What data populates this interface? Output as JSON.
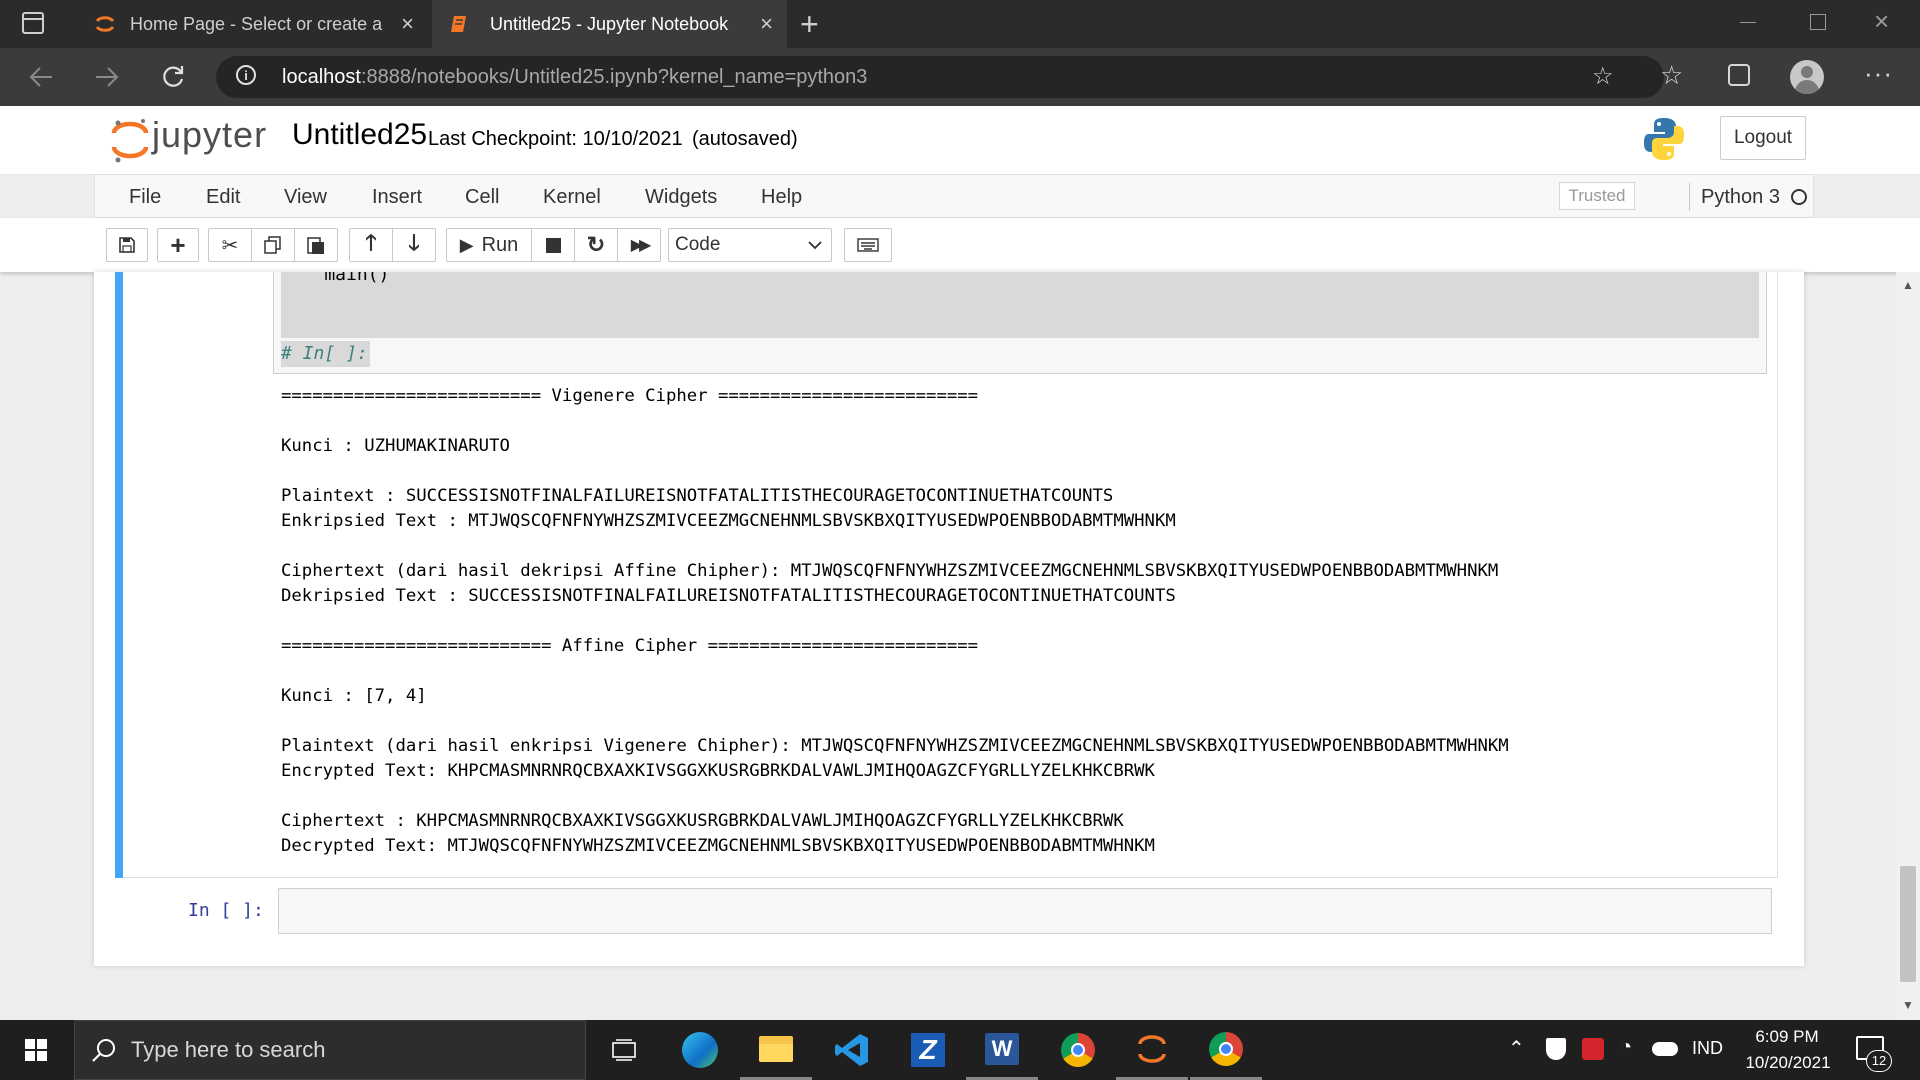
{
  "browser": {
    "tabs": [
      {
        "title": "Home Page - Select or create a notebook",
        "active": false
      },
      {
        "title": "Untitled25 - Jupyter Notebook",
        "active": true
      }
    ],
    "url_host": "localhost",
    "url_rest": ":8888/notebooks/Untitled25.ipynb?kernel_name=python3"
  },
  "jupyter": {
    "logo_text": "jupyter",
    "notebook_name": "Untitled25",
    "checkpoint": "Last Checkpoint: 10/10/2021",
    "autosaved": "(autosaved)",
    "logout_label": "Logout",
    "menu": [
      "File",
      "Edit",
      "View",
      "Insert",
      "Cell",
      "Kernel",
      "Widgets",
      "Help"
    ],
    "trusted_label": "Trusted",
    "kernel_name": "Python 3",
    "toolbar": {
      "run_label": "Run",
      "cell_type": "Code"
    }
  },
  "cell": {
    "code_tail": "    main()",
    "comment_line": "# In[ ]:",
    "output_lines": [
      "========================= Vigenere Cipher =========================",
      "",
      "Kunci : UZHUMAKINARUTO",
      "",
      "Plaintext : SUCCESSISNOTFINALFAILUREISNOTFATALITISTHECOURAGETOCONTINUETHATCOUNTS",
      "Enkripsied Text : MTJWQSCQFNFNYWHZSZMIVCEEZMGCNEHNMLSBVSKBXQITYUSEDWPOENBBODABMTMWHNKM",
      "",
      "Ciphertext (dari hasil dekripsi Affine Chipher): MTJWQSCQFNFNYWHZSZMIVCEEZMGCNEHNMLSBVSKBXQITYUSEDWPOENBBODABMTMWHNKM",
      "Dekripsied Text : SUCCESSISNOTFINALFAILUREISNOTFATALITISTHECOURAGETOCONTINUETHATCOUNTS",
      "",
      "========================== Affine Cipher ==========================",
      "",
      "Kunci : [7, 4]",
      "",
      "Plaintext (dari hasil enkripsi Vigenere Chipher): MTJWQSCQFNFNYWHZSZMIVCEEZMGCNEHNMLSBVSKBXQITYUSEDWPOENBBODABMTMWHNKM",
      "Encrypted Text: KHPCMASMNRNRQCBXAXKIVSGGXKUSRGBRKDALVAWLJMIHQOAGZCFYGRLLYZELKHKCBRWK",
      "",
      "Ciphertext : KHPCMASMNRNRQCBXAXKIVSGGXKUSRGBRKDALVAWLJMIHQOAGZCFYGRLLYZELKHKCBRWK",
      "Decrypted Text: MTJWQSCQFNFNYWHZSZMIVCEEZMGCNEHNMLSBVSKBXQITYUSEDWPOENBBODABMTMWHNKM"
    ],
    "next_prompt": "In [ ]:"
  },
  "taskbar": {
    "search_placeholder": "Type here to search",
    "language": "IND",
    "time": "6:09 PM",
    "date": "10/20/2021",
    "notification_count": "12"
  },
  "colors": {
    "jupyter_orange": "#f37726",
    "cell_selected_border": "#42a5f5",
    "prompt_blue": "#303f9f",
    "comment_green": "#408080"
  }
}
